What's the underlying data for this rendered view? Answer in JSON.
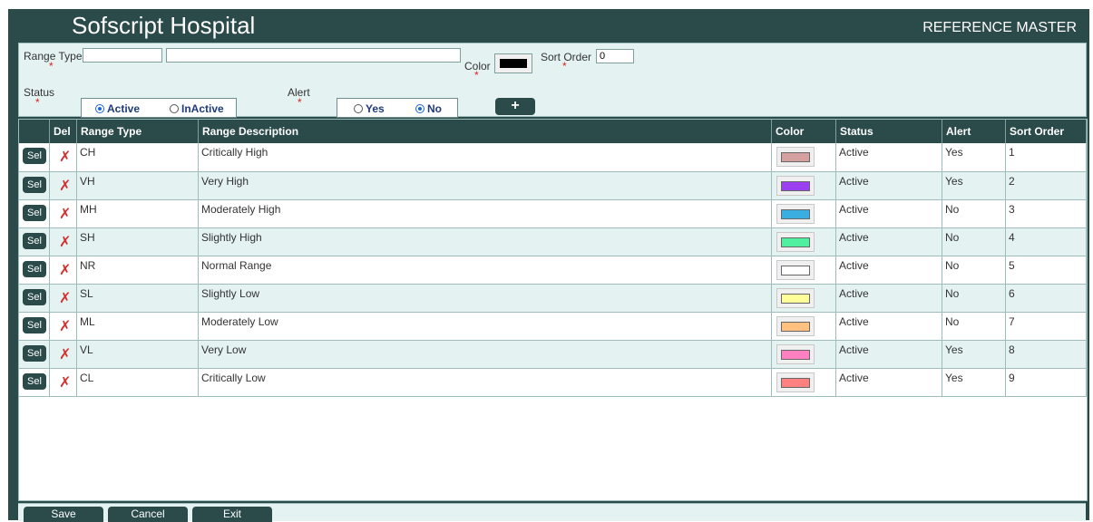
{
  "header": {
    "hospital": "Sofscript Hospital",
    "module": "REFERENCE MASTER"
  },
  "form": {
    "range_type_label": "Range Type",
    "range_type_code": "",
    "range_description": "",
    "color_label": "Color",
    "color_value": "#000000",
    "sort_order_label": "Sort Order",
    "sort_order_value": "0",
    "status_label": "Status",
    "status_options": [
      "Active",
      "InActive"
    ],
    "status_selected": "Active",
    "alert_label": "Alert",
    "alert_options": [
      "Yes",
      "No"
    ],
    "alert_selected": "No",
    "required_mark": "*",
    "add_button": "+"
  },
  "table": {
    "columns": [
      "",
      "Del",
      "Range Type",
      "Range Description",
      "Color",
      "Status",
      "Alert",
      "Sort Order"
    ],
    "sel_label": "Sel",
    "del_icon": "✗",
    "rows": [
      {
        "code": "CH",
        "description": "Critically High",
        "color": "#d4a0a0",
        "status": "Active",
        "alert": "Yes",
        "sort": "1"
      },
      {
        "code": "VH",
        "description": "Very High",
        "color": "#9b40f0",
        "status": "Active",
        "alert": "Yes",
        "sort": "2"
      },
      {
        "code": "MH",
        "description": "Moderately High",
        "color": "#3aaee0",
        "status": "Active",
        "alert": "No",
        "sort": "3"
      },
      {
        "code": "SH",
        "description": "Slightly High",
        "color": "#50f0a0",
        "status": "Active",
        "alert": "No",
        "sort": "4"
      },
      {
        "code": "NR",
        "description": "Normal Range",
        "color": "#ffffff",
        "status": "Active",
        "alert": "No",
        "sort": "5"
      },
      {
        "code": "SL",
        "description": "Slightly Low",
        "color": "#ffff99",
        "status": "Active",
        "alert": "No",
        "sort": "6"
      },
      {
        "code": "ML",
        "description": "Moderately Low",
        "color": "#ffc080",
        "status": "Active",
        "alert": "No",
        "sort": "7"
      },
      {
        "code": "VL",
        "description": "Very Low",
        "color": "#ff80c0",
        "status": "Active",
        "alert": "Yes",
        "sort": "8"
      },
      {
        "code": "CL",
        "description": "Critically Low",
        "color": "#ff8080",
        "status": "Active",
        "alert": "Yes",
        "sort": "9"
      }
    ]
  },
  "footer": {
    "save": "Save",
    "cancel": "Cancel",
    "exit": "Exit"
  }
}
